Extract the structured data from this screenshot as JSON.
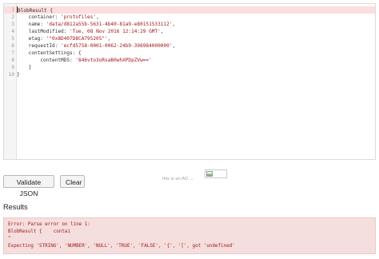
{
  "editor": {
    "line_numbers": [
      "1",
      "2",
      "3",
      "4",
      "5",
      "6",
      "7",
      "8",
      "9",
      "10"
    ],
    "lines": [
      [
        {
          "t": "BlobResult {",
          "s": "plain"
        }
      ],
      [
        {
          "t": "    container: ",
          "s": "plain"
        },
        {
          "t": "'protofiles'",
          "s": "str"
        },
        {
          "t": ",",
          "s": "plain"
        }
      ],
      [
        {
          "t": "    name: ",
          "s": "plain"
        },
        {
          "t": "'data/d812a55b-5631-4b40-81a9-e80151533112'",
          "s": "str"
        },
        {
          "t": ",",
          "s": "plain"
        }
      ],
      [
        {
          "t": "    lastModified: ",
          "s": "plain"
        },
        {
          "t": "'Tue, 08 Nov 2016 12:14:29 GMT'",
          "s": "str"
        },
        {
          "t": ",",
          "s": "plain"
        }
      ],
      [
        {
          "t": "    etag: ",
          "s": "plain"
        },
        {
          "t": "'\"0x8D407D8CA795205\"'",
          "s": "str"
        },
        {
          "t": ",",
          "s": "plain"
        }
      ],
      [
        {
          "t": "    requestId: ",
          "s": "plain"
        },
        {
          "t": "'ecfd5758-0001-0062-24b9-396984000000'",
          "s": "str"
        },
        {
          "t": ",",
          "s": "plain"
        }
      ],
      [
        {
          "t": "    contentSettings: {",
          "s": "plain"
        }
      ],
      [
        {
          "t": "        contentMD5: ",
          "s": "plain"
        },
        {
          "t": "'846vto3oRsaB0whXPDpZVw=='",
          "s": "str"
        }
      ],
      [
        {
          "t": "    }",
          "s": "plain"
        }
      ],
      [
        {
          "t": "}",
          "s": "plain"
        }
      ]
    ]
  },
  "toolbar": {
    "validate_label": "Validate JSON",
    "clear_label": "Clear",
    "ad_text": "this is an AD →"
  },
  "results": {
    "title": "Results",
    "error_lines": [
      "Error: Parse error on line 1:",
      "BlobResult {    contai",
      "^",
      "Expecting 'STRING', 'NUMBER', 'NULL', 'TRUE', 'FALSE', '{', '[', got 'undefined'"
    ]
  },
  "colors": {
    "error_text": "#a11a1a",
    "error_background": "#f5dede",
    "highlight_line": "#fcdede",
    "string": "#a4161a"
  }
}
